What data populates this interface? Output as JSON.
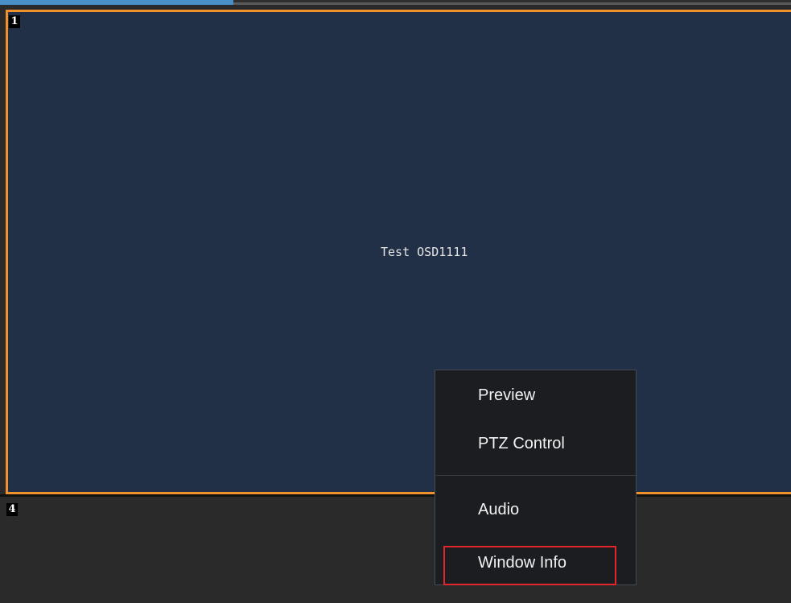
{
  "panes": [
    {
      "number": "1",
      "osd": "Test OSD1111",
      "selected": true
    },
    {
      "number": "4",
      "osd": ""
    }
  ],
  "context_menu": {
    "items": [
      {
        "label": "Preview"
      },
      {
        "label": "PTZ Control"
      },
      {
        "label": "Audio"
      },
      {
        "label": "Window Info",
        "highlighted": true
      }
    ]
  },
  "colors": {
    "selected_border": "#f0922b",
    "pane_background": "#213046",
    "empty_pane_background": "#2a2a2a",
    "menu_background": "#1c1d21",
    "highlight_border": "#e3262b"
  }
}
